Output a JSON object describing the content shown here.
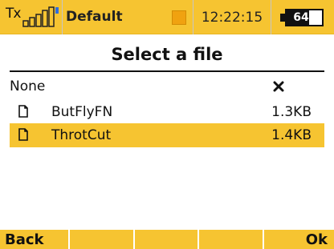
{
  "topbar": {
    "tx_label": "Tx",
    "model_name": "Default",
    "clock": "12:22:15",
    "battery_text": "64%",
    "battery_level": 0.64
  },
  "dialog": {
    "title": "Select a file"
  },
  "files": [
    {
      "name": "None",
      "size": "",
      "icon": "close-icon"
    },
    {
      "name": "ButFlyFN",
      "size": "1.3KB",
      "icon": "file-icon"
    },
    {
      "name": "ThrotCut",
      "size": "1.4KB",
      "icon": "file-icon",
      "selected": true
    }
  ],
  "bottombar": {
    "back_label": "Back",
    "ok_label": "Ok"
  },
  "colors": {
    "accent": "#f6c431",
    "text": "#111111",
    "background": "#ffffff"
  }
}
